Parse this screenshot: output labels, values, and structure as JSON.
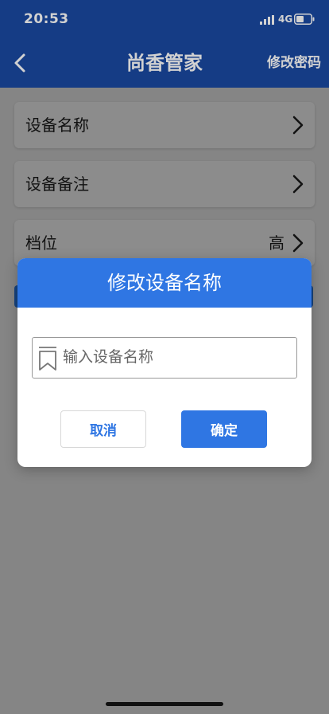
{
  "status_bar": {
    "time": "20:53",
    "network": "4G",
    "signal_icon": "signal-bars-icon",
    "battery_icon": "battery-icon"
  },
  "nav": {
    "back_icon": "chevron-left-icon",
    "title": "尚香管家",
    "action_label": "修改密码"
  },
  "settings": {
    "items": [
      {
        "label": "设备名称",
        "value": ""
      },
      {
        "label": "设备备注",
        "value": ""
      },
      {
        "label": "档位",
        "value": "高"
      }
    ]
  },
  "dialog": {
    "title": "修改设备名称",
    "input_placeholder": "输入设备名称",
    "input_value": "",
    "input_icon": "bookmark-icon",
    "cancel_label": "取消",
    "confirm_label": "确定"
  },
  "colors": {
    "header_bg": "#1a4aa3",
    "accent": "#2f76e3",
    "overlay": "rgba(0,0,0,0.45)"
  }
}
